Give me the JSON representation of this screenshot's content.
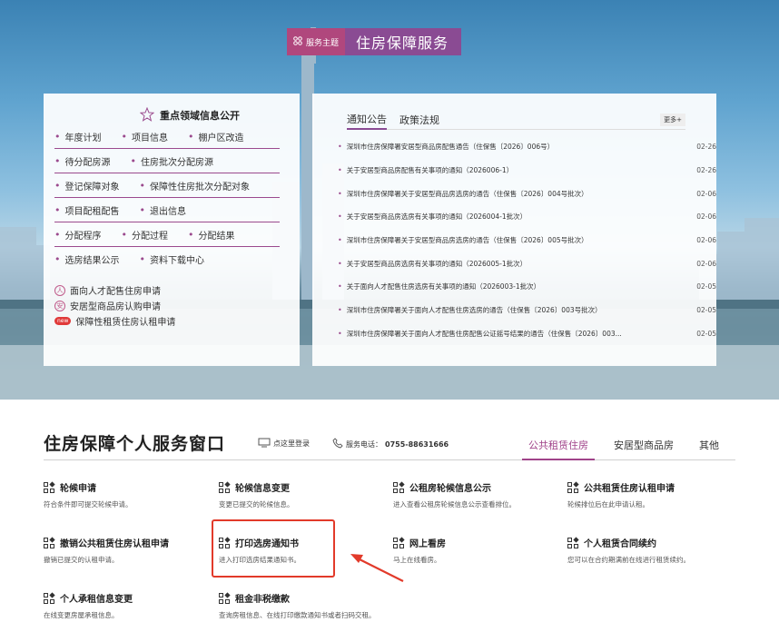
{
  "theme": {
    "tag": "服务主题",
    "title": "住房保障服务"
  },
  "left_panel": {
    "heading": "重点领域信息公开",
    "rows": [
      [
        "年度计划",
        "项目信息",
        "棚户区改造"
      ],
      [
        "待分配房源",
        "住房批次分配房源"
      ],
      [
        "登记保障对象",
        "保障性住房批次分配对象"
      ],
      [
        "项目配租配售",
        "退出信息"
      ],
      [
        "分配程序",
        "分配过程",
        "分配结果"
      ],
      [
        "选房结果公示",
        "资料下载中心"
      ]
    ],
    "links": [
      {
        "icon": "人",
        "label": "面向人才配售住房申请"
      },
      {
        "icon": "安",
        "label": "安居型商品房认购申请"
      },
      {
        "icon": "new",
        "label": "保障性租赁住房认租申请"
      }
    ]
  },
  "right_panel": {
    "tabs": [
      "通知公告",
      "政策法规"
    ],
    "more": "更多+",
    "news": [
      {
        "title": "深圳市住房保障署安居型商品房配售通告（住保售〔2026〕006号）",
        "date": "02-26"
      },
      {
        "title": "关于安居型商品房配售有关事项的通知（2026006-1）",
        "date": "02-26"
      },
      {
        "title": "深圳市住房保障署关于安居型商品房选房的通告（住保售〔2026〕004号批次）",
        "date": "02-06"
      },
      {
        "title": "关于安居型商品房选房有关事项的通知（2026004-1批次）",
        "date": "02-06"
      },
      {
        "title": "深圳市住房保障署关于安居型商品房选房的通告（住保售〔2026〕005号批次）",
        "date": "02-06"
      },
      {
        "title": "关于安居型商品房选房有关事项的通知（2026005-1批次）",
        "date": "02-06"
      },
      {
        "title": "关于面向人才配售住房选房有关事项的通知（2026003-1批次）",
        "date": "02-05"
      },
      {
        "title": "深圳市住房保障署关于面向人才配售住房选房的通告（住保售〔2026〕003号批次）",
        "date": "02-05"
      },
      {
        "title": "深圳市住房保障署关于面向人才配售住房配售公证摇号结果的通告（住保售〔2026〕003...",
        "date": "02-05"
      }
    ]
  },
  "service_window": {
    "title": "住房保障个人服务窗口",
    "login": "点这里登录",
    "phone_label": "服务电话：",
    "phone": "0755-88631666",
    "tabs": [
      "公共租赁住房",
      "安居型商品房",
      "其他"
    ],
    "items": [
      {
        "title": "轮候申请",
        "desc": "符合条件即可提交轮候申请。"
      },
      {
        "title": "轮候信息变更",
        "desc": "变更已提交的轮候信息。"
      },
      {
        "title": "公租房轮候信息公示",
        "desc": "进入查看公租房轮候信息公示查看排位。"
      },
      {
        "title": "公共租赁住房认租申请",
        "desc": "轮候排位后在此申请认租。"
      },
      {
        "title": "撤销公共租赁住房认租申请",
        "desc": "撤销已提交的认租申请。"
      },
      {
        "title": "打印选房通知书",
        "desc": "进入打印选房结果通知书。"
      },
      {
        "title": "网上看房",
        "desc": "马上在线看房。"
      },
      {
        "title": "个人租赁合同续约",
        "desc": "您可以在合约期满前在线进行租赁续约。"
      },
      {
        "title": "个人承租信息变更",
        "desc": "在线变更房屋承租信息。"
      },
      {
        "title": "租金非税缴款",
        "desc": "查询房租信息、在线打印缴款通知书或者扫码交租。"
      }
    ]
  },
  "colors": {
    "accent": "#a0438a",
    "highlight": "#e23a2a",
    "theme_tag": "#b0477d",
    "theme_title": "#8a4b93"
  }
}
